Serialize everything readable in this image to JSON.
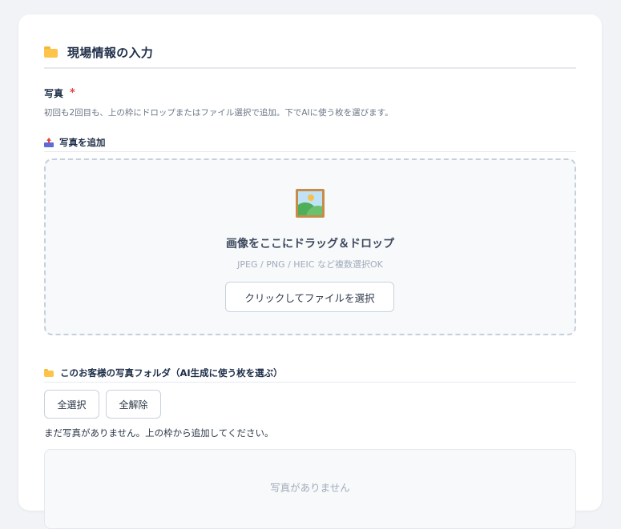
{
  "section": {
    "title": "現場情報の入力",
    "icon": "folder-icon"
  },
  "photo_field": {
    "label": "写真",
    "required_mark": "*",
    "hint": "初回も2回目も、上の枠にドロップまたはファイル選択で追加。下でAIに使う枚を選びます。"
  },
  "add_photos": {
    "label": "写真を追加",
    "icon": "inbox-tray-icon"
  },
  "dropzone": {
    "icon": "framed-picture-icon",
    "title": "画像をここにドラッグ＆ドロップ",
    "formats": "JPEG / PNG / HEIC など複数選択OK",
    "button_label": "クリックしてファイルを選択"
  },
  "customer_folder": {
    "label": "このお客様の写真フォルダ（AI生成に使う枚を選ぶ）",
    "icon": "folder-icon",
    "select_all_label": "全選択",
    "deselect_all_label": "全解除",
    "empty_message": "まだ写真がありません。上の枠から追加してください。",
    "placeholder": "写真がありません"
  },
  "colors": {
    "accent_required": "#e04646",
    "title": "#1e2e48",
    "folder": "#fcc54a"
  }
}
